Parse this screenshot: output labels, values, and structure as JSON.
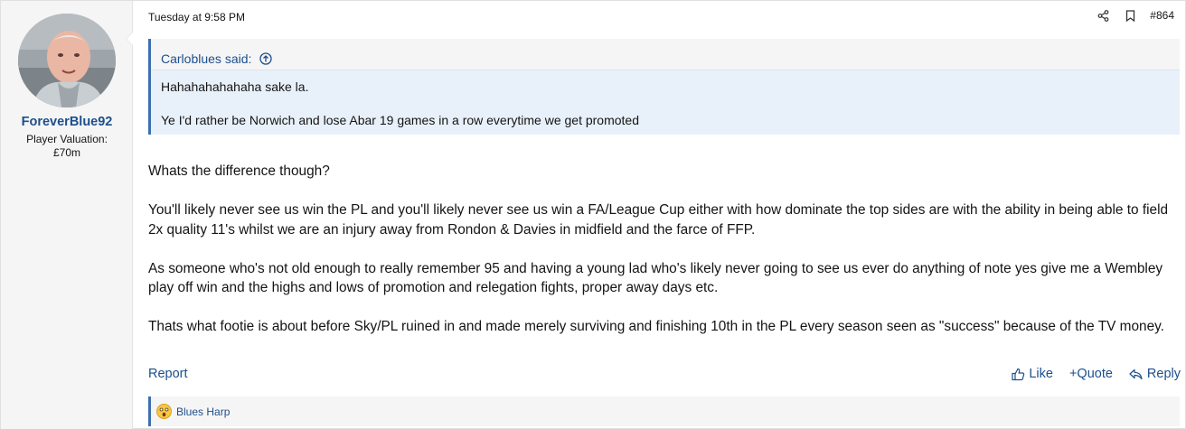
{
  "user": {
    "name": "ForeverBlue92",
    "title_line1": "Player Valuation:",
    "title_line2": "£70m"
  },
  "post": {
    "date": "Tuesday at 9:58 PM",
    "number": "#864"
  },
  "quote": {
    "author_label": "Carloblues said:",
    "lines": [
      "Hahahahahahaha sake la.",
      "Ye I'd rather be Norwich and lose Abar 19 games in a row everytime we get promoted"
    ]
  },
  "body": {
    "paragraphs": [
      "Whats the difference though?",
      "You'll likely never see us win the PL and you'll likely never see us win a FA/League Cup either with how dominate the top sides are with the ability in being able to field 2x quality 11's whilst we are an injury away from Rondon & Davies in midfield and the farce of FFP.",
      "As someone who's not old enough to really remember 95 and having a young lad who's likely never going to see us ever do anything of note yes give me a Wembley play off win and the highs and lows of promotion and relegation fights, proper away days etc.",
      "Thats what footie is about before Sky/PL ruined in and made merely surviving and finishing 10th in the PL every season seen as \"success\" because of the TV money."
    ]
  },
  "footer": {
    "report": "Report",
    "like": "Like",
    "quote": "+Quote",
    "reply": "Reply"
  },
  "reactions": {
    "text": "Blues Harp"
  },
  "colors": {
    "link": "#1d4f8c",
    "quote_bg": "#e8f1fa",
    "accent": "#3d6fb0"
  }
}
